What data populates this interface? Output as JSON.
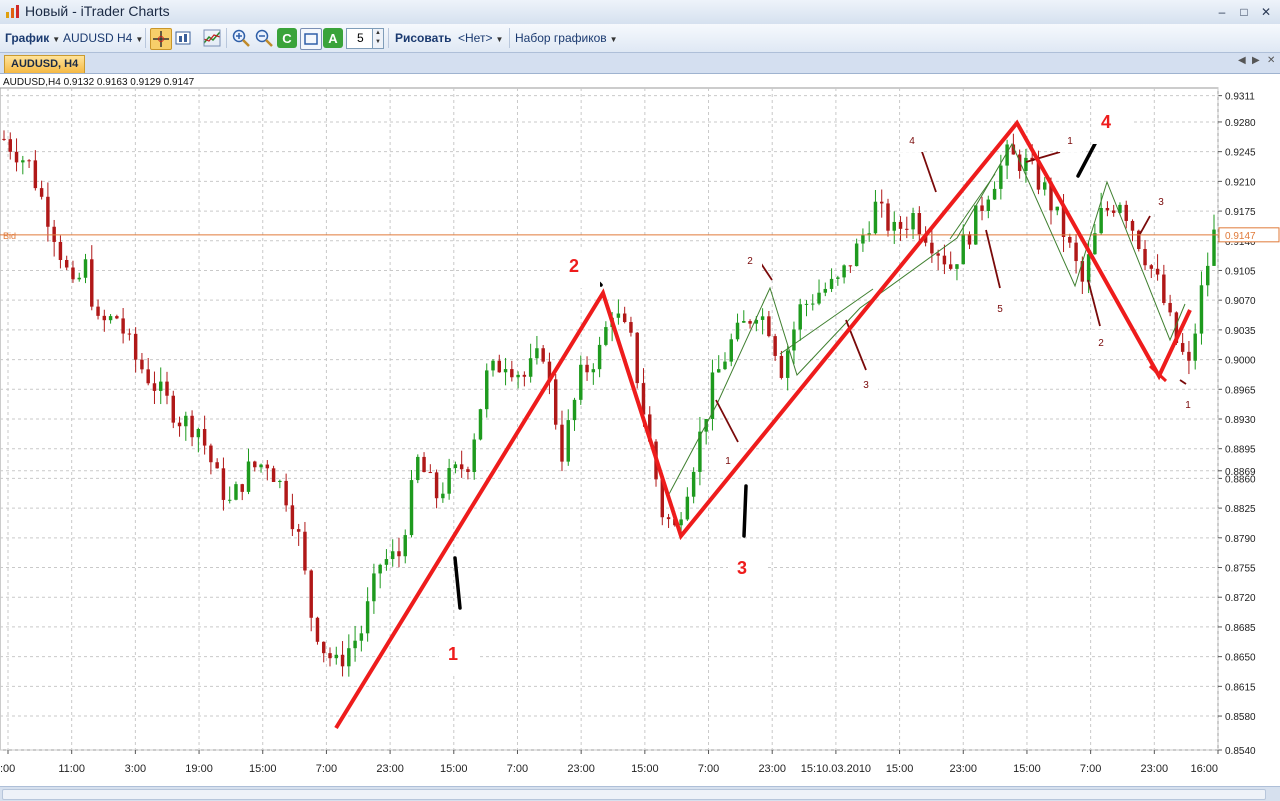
{
  "window": {
    "title": "Новый - iTrader Charts"
  },
  "toolbar": {
    "chart_menu": "График",
    "symbol_menu": "AUDUSD  H4",
    "count_value": "5",
    "draw_label": "Рисовать",
    "draw_value": "<Нет>",
    "chart_set_menu": "Набор графиков"
  },
  "tab": {
    "label": "AUDUSD, H4"
  },
  "chart_data": {
    "type": "candlestick",
    "symbol": "AUDUSD",
    "timeframe": "H4",
    "ohlc_header": "AUDUSD,H4  0.9132  0.9163  0.9129  0.9147",
    "bid_label": "Bid",
    "bid_value": "0.9147",
    "ylim": [
      0.854,
      0.932
    ],
    "y_ticks": [
      "0.9311",
      "0.9280",
      "0.9245",
      "0.9210",
      "0.9175",
      "0.9140",
      "0.9105",
      "0.9070",
      "0.9035",
      "0.9000",
      "0.8965",
      "0.8930",
      "0.8895",
      "0.8869",
      "0.8860",
      "0.8825",
      "0.8790",
      "0.8755",
      "0.8720",
      "0.8685",
      "0.8650",
      "0.8615",
      "0.8580",
      "0.8540"
    ],
    "x_ticks": [
      ":00",
      "11:00",
      "3:00",
      "19:00",
      "15:00",
      "7:00",
      "23:00",
      "15:00",
      "7:00",
      "23:00",
      "15:00",
      "7:00",
      "23:00",
      "15:10.03.2010",
      "15:00",
      "23:00",
      "15:00",
      "7:00",
      "23:00",
      "16:00"
    ],
    "price_path": [
      [
        0,
        0.926
      ],
      [
        4,
        0.923
      ],
      [
        8,
        0.915
      ],
      [
        11,
        0.908
      ],
      [
        13,
        0.911
      ],
      [
        15,
        0.904
      ],
      [
        18,
        0.905
      ],
      [
        21,
        0.9
      ],
      [
        25,
        0.896
      ],
      [
        28,
        0.893
      ],
      [
        31,
        0.892
      ],
      [
        34,
        0.886
      ],
      [
        36,
        0.883
      ],
      [
        39,
        0.887
      ],
      [
        42,
        0.888
      ],
      [
        45,
        0.884
      ],
      [
        47,
        0.879
      ],
      [
        49,
        0.87
      ],
      [
        51,
        0.866
      ],
      [
        53,
        0.864
      ],
      [
        55,
        0.866
      ],
      [
        57,
        0.868
      ],
      [
        60,
        0.876
      ],
      [
        63,
        0.877
      ],
      [
        66,
        0.888
      ],
      [
        69,
        0.884
      ],
      [
        71,
        0.886
      ],
      [
        74,
        0.888
      ],
      [
        77,
        0.898
      ],
      [
        80,
        0.9
      ],
      [
        83,
        0.898
      ],
      [
        86,
        0.901
      ],
      [
        89,
        0.889
      ],
      [
        92,
        0.898
      ],
      [
        95,
        0.901
      ],
      [
        97,
        0.906
      ],
      [
        100,
        0.902
      ],
      [
        103,
        0.89
      ],
      [
        105,
        0.882
      ],
      [
        107,
        0.88
      ],
      [
        110,
        0.888
      ],
      [
        113,
        0.897
      ],
      [
        116,
        0.902
      ],
      [
        120,
        0.906
      ],
      [
        122,
        0.904
      ],
      [
        124,
        0.899
      ],
      [
        127,
        0.906
      ],
      [
        130,
        0.908
      ],
      [
        133,
        0.909
      ],
      [
        136,
        0.913
      ],
      [
        139,
        0.918
      ],
      [
        142,
        0.915
      ],
      [
        145,
        0.917
      ],
      [
        148,
        0.914
      ],
      [
        151,
        0.911
      ],
      [
        154,
        0.915
      ],
      [
        157,
        0.92
      ],
      [
        160,
        0.924
      ],
      [
        163,
        0.923
      ],
      [
        166,
        0.92
      ],
      [
        169,
        0.915
      ],
      [
        172,
        0.909
      ],
      [
        175,
        0.917
      ],
      [
        178,
        0.919
      ],
      [
        181,
        0.914
      ],
      [
        184,
        0.909
      ],
      [
        187,
        0.902
      ],
      [
        189,
        0.899
      ],
      [
        191,
        0.908
      ],
      [
        193,
        0.9147
      ]
    ],
    "candle_count": 194,
    "wave_labels": {
      "primary": [
        "1",
        "2",
        "3",
        "4"
      ],
      "secondary": [
        "1",
        "2",
        "3",
        "4",
        "5",
        "1",
        "2",
        "3",
        "1",
        "2",
        "3"
      ]
    },
    "colors": {
      "bull": "#1e9a1e",
      "bear": "#b01818",
      "wave_red": "#ee1c1c",
      "thin_green": "#3f7f2f",
      "bid_line": "#e07a3a",
      "grid": "#c9c9c9"
    }
  }
}
